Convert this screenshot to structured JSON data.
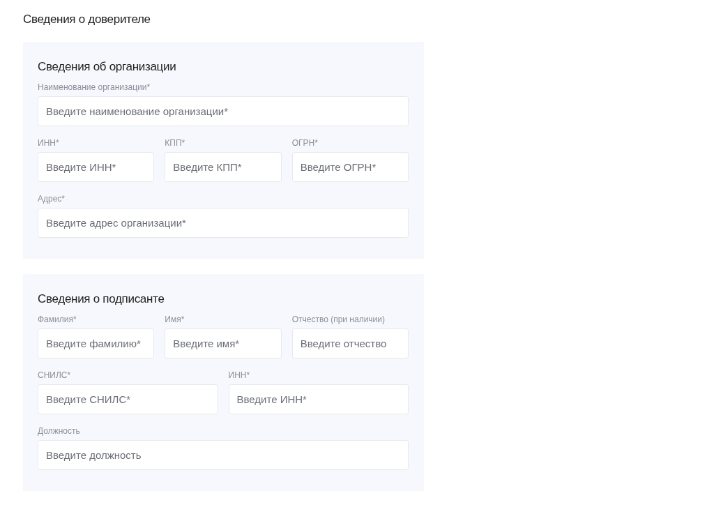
{
  "page_title": "Сведения о доверителе",
  "sections": [
    {
      "title": "Сведения об организации",
      "rows": [
        [
          {
            "label": "Наименование организации*",
            "placeholder": "Введите наименование организации*"
          }
        ],
        [
          {
            "label": "ИНН*",
            "placeholder": "Введите ИНН*"
          },
          {
            "label": "КПП*",
            "placeholder": "Введите КПП*"
          },
          {
            "label": "ОГРН*",
            "placeholder": "Введите ОГРН*"
          }
        ],
        [
          {
            "label": "Адрес*",
            "placeholder": "Введите адрес организации*"
          }
        ]
      ]
    },
    {
      "title": "Сведения о подписанте",
      "rows": [
        [
          {
            "label": "Фамилия*",
            "placeholder": "Введите фамилию*"
          },
          {
            "label": "Имя*",
            "placeholder": "Введите имя*"
          },
          {
            "label": "Отчество (при наличии)",
            "placeholder": "Введите отчество"
          }
        ],
        [
          {
            "label": "СНИЛС*",
            "placeholder": "Введите СНИЛС*"
          },
          {
            "label": "ИНН*",
            "placeholder": "Введите ИНН*"
          }
        ],
        [
          {
            "label": "Должность",
            "placeholder": "Введите должность"
          }
        ]
      ]
    }
  ]
}
